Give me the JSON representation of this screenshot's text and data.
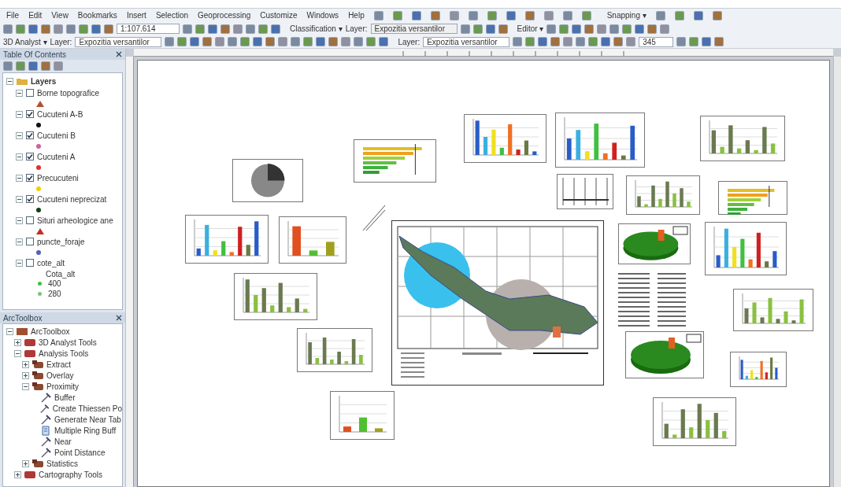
{
  "menu": [
    "File",
    "Edit",
    "View",
    "Bookmarks",
    "Insert",
    "Selection",
    "Geoprocessing",
    "Customize",
    "Windows",
    "Help"
  ],
  "toolbar_top": {
    "snapping": "Snapping ▾"
  },
  "toolbar_standard": {
    "scale": "1:107.614",
    "classification": "Classification ▾",
    "layer_label": "Layer:",
    "layer_value": "Expozitia versantilor",
    "editor": "Editor ▾"
  },
  "toolbar_3d": {
    "analyst": "3D Analyst ▾",
    "layer_label": "Layer:",
    "layer_value": "Expozitia versantilor",
    "layer_label_2": "Layer:",
    "layer_value_2": "Expozitia versantilor",
    "zoom": "345"
  },
  "toc": {
    "title": "Table Of Contents",
    "root": "Layers",
    "layers": [
      {
        "name": "Borne topografice",
        "checked": false,
        "kind": "triangle",
        "color": "#b5502f"
      },
      {
        "name": "Cucuteni A-B",
        "checked": true,
        "kind": "dot",
        "color": "#111111"
      },
      {
        "name": "Cucuteni B",
        "checked": true,
        "kind": "dot",
        "color": "#d0609a"
      },
      {
        "name": "Cucuteni A",
        "checked": true,
        "kind": "dot",
        "color": "#e03030"
      },
      {
        "name": "Precucuteni",
        "checked": true,
        "kind": "dot",
        "color": "#f0d000"
      },
      {
        "name": "Cucuteni neprecizat",
        "checked": true,
        "kind": "dot",
        "color": "#104010"
      },
      {
        "name": "Situri arheologice ane",
        "checked": false,
        "kind": "triangle",
        "color": "#c03020"
      },
      {
        "name": "puncte_foraje",
        "checked": false,
        "kind": "dot",
        "color": "#5060c0"
      },
      {
        "name": "cote_alt",
        "checked": false,
        "kind": "classes",
        "sub": "Cota_alt",
        "values": [
          {
            "label": "400",
            "color": "#40c040"
          },
          {
            "label": "280",
            "color": "#80c080"
          }
        ]
      }
    ]
  },
  "toolbox": {
    "title": "ArcToolbox",
    "tree": [
      {
        "label": "ArcToolbox",
        "kind": "box",
        "expanded": true,
        "children": [
          {
            "label": "3D Analyst Tools",
            "kind": "toolbox",
            "expanded": false
          },
          {
            "label": "Analysis Tools",
            "kind": "toolbox",
            "expanded": true,
            "children": [
              {
                "label": "Extract",
                "kind": "toolset",
                "expanded": false
              },
              {
                "label": "Overlay",
                "kind": "toolset",
                "expanded": false
              },
              {
                "label": "Proximity",
                "kind": "toolset",
                "expanded": true,
                "children": [
                  {
                    "label": "Buffer",
                    "kind": "tool"
                  },
                  {
                    "label": "Create Thiessen Po",
                    "kind": "tool"
                  },
                  {
                    "label": "Generate Near Tab",
                    "kind": "tool"
                  },
                  {
                    "label": "Multiple Ring Buff",
                    "kind": "script"
                  },
                  {
                    "label": "Near",
                    "kind": "tool"
                  },
                  {
                    "label": "Point Distance",
                    "kind": "tool"
                  }
                ]
              },
              {
                "label": "Statistics",
                "kind": "toolset",
                "expanded": false
              }
            ]
          },
          {
            "label": "Cartography Tools",
            "kind": "toolbox",
            "expanded": false
          }
        ]
      }
    ]
  }
}
